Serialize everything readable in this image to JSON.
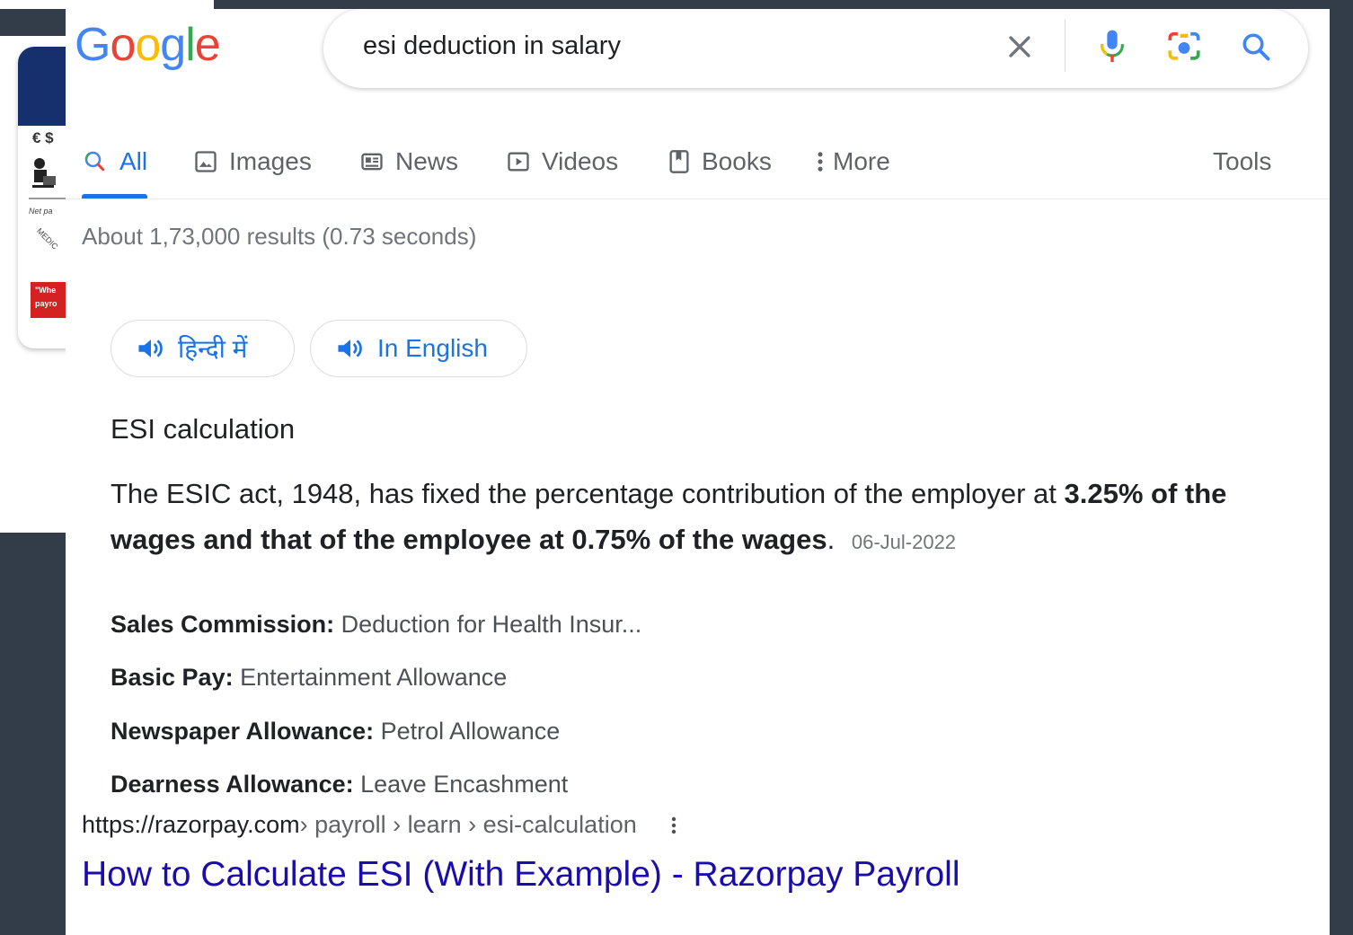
{
  "colors": {
    "page_bg": "#323d49",
    "accent_blue": "#1a73e8",
    "link": "#1a0dab",
    "logo": [
      "#4285f4",
      "#ea4335",
      "#fbbc05",
      "#4285f4",
      "#34a853",
      "#ea4335"
    ]
  },
  "background_window": {
    "symbols": "€ $",
    "net_text": "Net pa",
    "slant_text": "MEDIC",
    "red_text_1": "\"Whe",
    "red_text_2": "payro"
  },
  "logo": {
    "letters": [
      "G",
      "o",
      "o",
      "g",
      "l",
      "e"
    ]
  },
  "search": {
    "value": "esi deduction in salary",
    "icons": [
      "close-icon",
      "microphone-icon",
      "camera-lens-icon",
      "search-icon"
    ]
  },
  "tabs": [
    {
      "label": "All",
      "icon": "search-icon",
      "active": true
    },
    {
      "label": "Images",
      "icon": "image-icon"
    },
    {
      "label": "News",
      "icon": "news-icon"
    },
    {
      "label": "Videos",
      "icon": "play-icon"
    },
    {
      "label": "Books",
      "icon": "book-icon"
    },
    {
      "label": "More",
      "icon": "vertical-dots-icon"
    }
  ],
  "tools_label": "Tools",
  "results_stats": "About 1,73,000 results (0.73 seconds)",
  "language_buttons": [
    {
      "label": "हिन्दी में",
      "icon": "speaker-icon"
    },
    {
      "label": "In English",
      "icon": "speaker-icon"
    }
  ],
  "snippet": {
    "title": "ESI calculation",
    "text_plain": "The ESIC act, 1948, has fixed the percentage contribution of the employer at ",
    "text_bold": "3.25% of the wages and that of the employee at 0.75% of the wages",
    "text_end": ".",
    "date": "06-Jul-2022"
  },
  "list": [
    {
      "label": "Sales Commission:",
      "value": "Deduction for Health Insur..."
    },
    {
      "label": "Basic Pay:",
      "value": "Entertainment Allowance"
    },
    {
      "label": "Newspaper Allowance:",
      "value": "Petrol Allowance"
    },
    {
      "label": "Dearness Allowance:",
      "value": "Leave Encashment"
    }
  ],
  "result": {
    "host": "https://razorpay.com",
    "breadcrumb": " › payroll › learn › esi-calculation",
    "title": "How to Calculate ESI (With Example) - Razorpay Payroll"
  }
}
